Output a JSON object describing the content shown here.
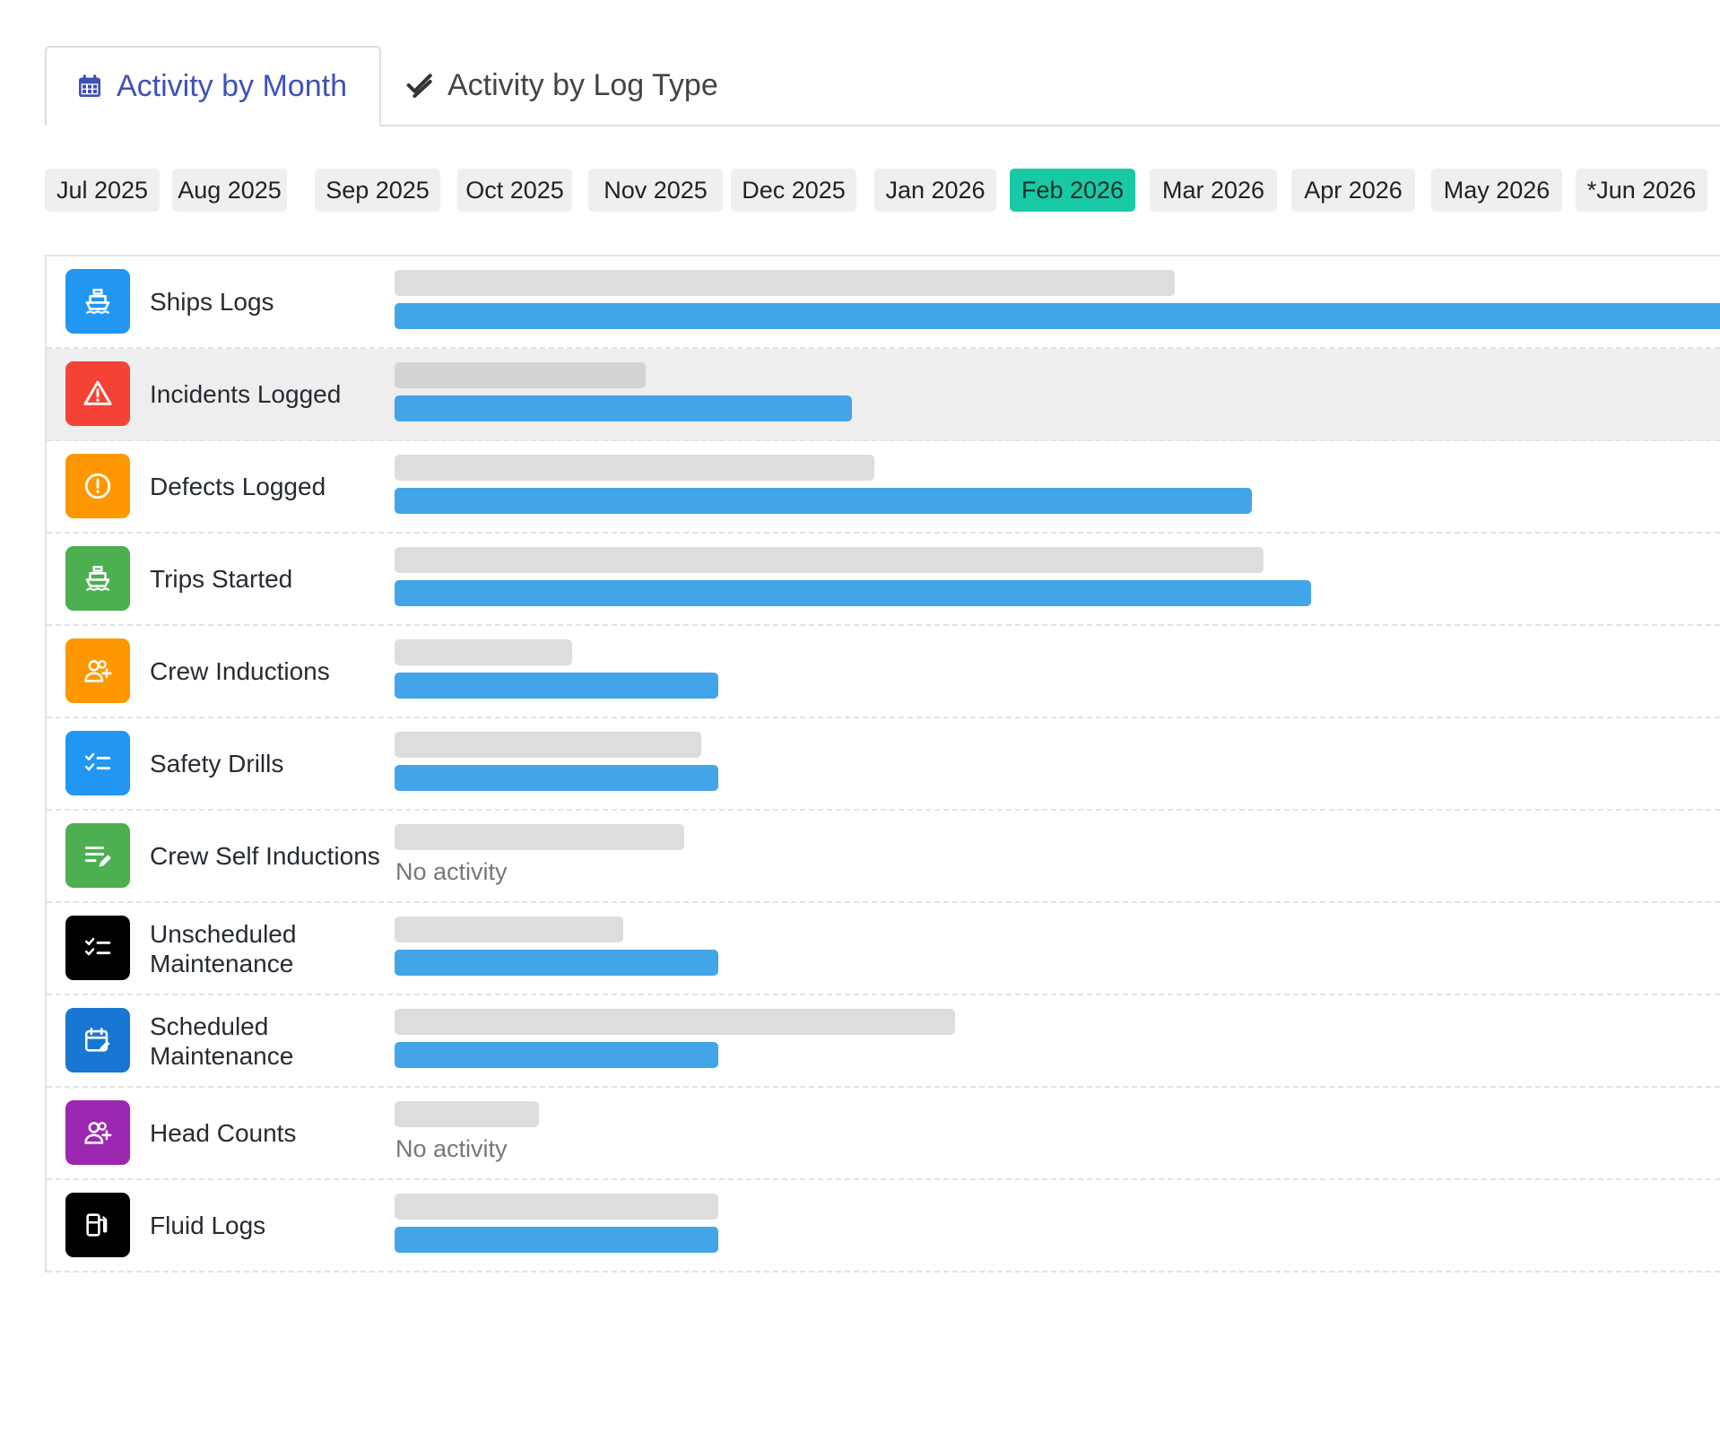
{
  "tabs": [
    {
      "label": "Activity by Month",
      "icon": "calendar-icon",
      "active": true
    },
    {
      "label": "Activity by Log Type",
      "icon": "double-check-icon",
      "active": false
    }
  ],
  "months": [
    "Jul 2025",
    "Aug 2025",
    "Sep 2025",
    "Oct 2025",
    "Nov 2025",
    "Dec 2025",
    "Jan 2026",
    "Feb 2026",
    "Mar 2026",
    "Apr 2026",
    "May 2026",
    "*Jun 2026"
  ],
  "selected_month": "Feb 2026",
  "colors": {
    "selected_month_bg": "#19c9a6",
    "current_bar": "#42a5e8",
    "previous_bar": "#dddddd",
    "active_tab_text": "#3f51b5"
  },
  "rows": [
    {
      "label": "Ships Logs",
      "icon": "ship-icon",
      "icon_color": "#2196f3",
      "previous": 0.59,
      "current": 1.0,
      "current_overflows": true,
      "highlight": false
    },
    {
      "label": "Incidents Logged",
      "icon": "warning-triangle-icon",
      "icon_color": "#f44336",
      "previous": 0.19,
      "current": 0.346,
      "highlight": true
    },
    {
      "label": "Defects Logged",
      "icon": "alert-circle-icon",
      "icon_color": "#ff9800",
      "previous": 0.363,
      "current": 0.648,
      "highlight": false
    },
    {
      "label": "Trips Started",
      "icon": "ship-icon",
      "icon_color": "#4caf50",
      "previous": 0.657,
      "current": 0.693,
      "highlight": false
    },
    {
      "label": "Crew Inductions",
      "icon": "add-user-icon",
      "icon_color": "#ff9800",
      "previous": 0.134,
      "current": 0.245,
      "highlight": false
    },
    {
      "label": "Safety Drills",
      "icon": "checklist-icon",
      "icon_color": "#2196f3",
      "previous": 0.232,
      "current": 0.245,
      "highlight": false
    },
    {
      "label": "Crew Self Inductions",
      "icon": "edit-list-icon",
      "icon_color": "#4caf50",
      "previous": 0.219,
      "current": 0,
      "no_activity_text": "No activity",
      "highlight": false
    },
    {
      "label": "Unscheduled Maintenance",
      "icon": "checklist-icon",
      "icon_color": "#000000",
      "previous": 0.173,
      "current": 0.245,
      "highlight": false
    },
    {
      "label": "Scheduled Maintenance",
      "icon": "calendar-edit-icon",
      "icon_color": "#1976d2",
      "previous": 0.424,
      "current": 0.245,
      "highlight": false
    },
    {
      "label": "Head Counts",
      "icon": "add-user-icon",
      "icon_color": "#9c27b0",
      "previous": 0.109,
      "current": 0,
      "no_activity_text": "No activity",
      "highlight": false
    },
    {
      "label": "Fluid Logs",
      "icon": "fuel-pump-icon",
      "icon_color": "#000000",
      "previous": 0.245,
      "current": 0.245,
      "highlight": false
    }
  ]
}
